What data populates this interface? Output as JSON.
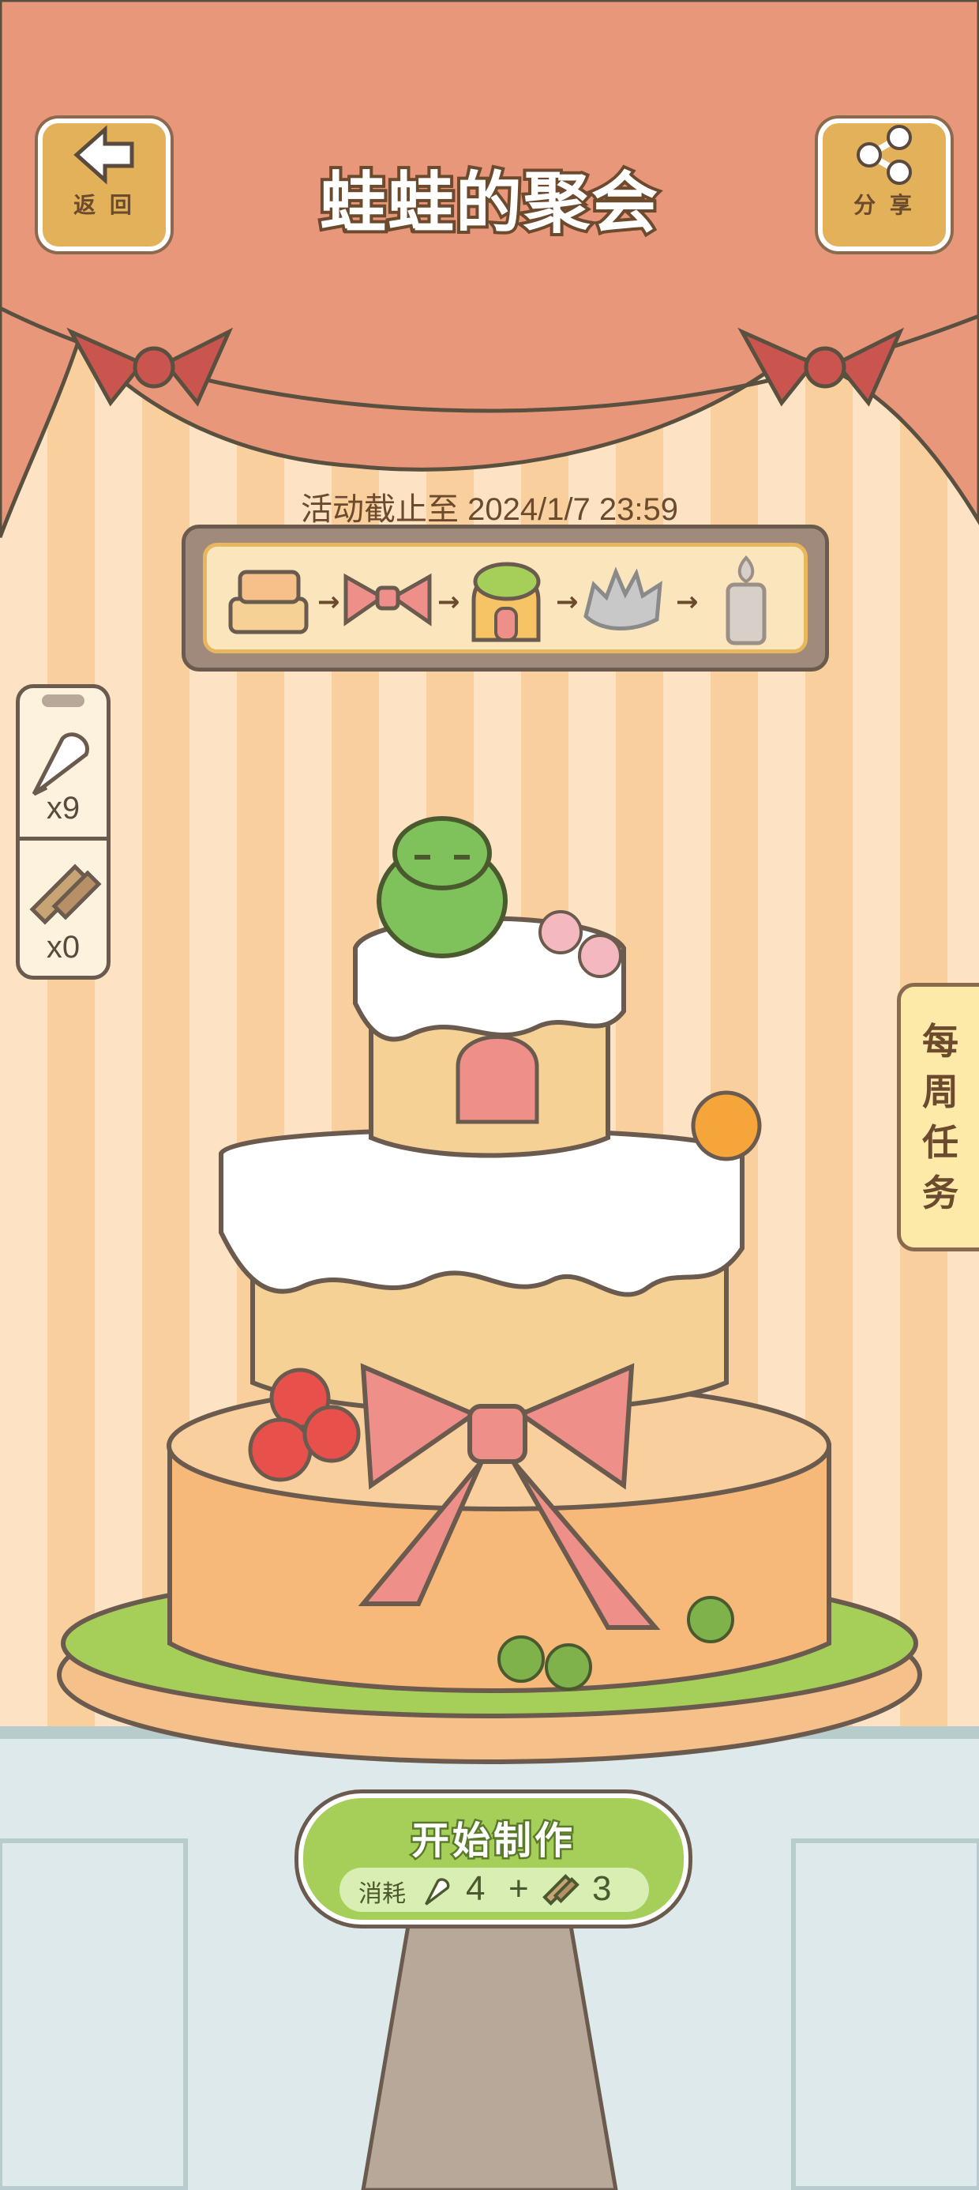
{
  "header": {
    "back_label": "返 回",
    "title": "蛙蛙的聚会",
    "share_label": "分 享"
  },
  "event": {
    "deadline": "活动截止至 2024/1/7 23:59"
  },
  "progress": {
    "steps": [
      "cake-layer-icon",
      "bow-icon",
      "house-cake-icon",
      "hedgehog-icon",
      "candle-icon"
    ],
    "arrow": "→"
  },
  "inventory": {
    "items": [
      {
        "icon": "cream-piping-bag-icon",
        "count": "x9"
      },
      {
        "icon": "spatula-icon",
        "count": "x0"
      }
    ]
  },
  "weekly_tasks": {
    "label_chars": [
      "每",
      "周",
      "任",
      "务"
    ]
  },
  "start": {
    "label": "开始制作",
    "cost_label": "消耗",
    "cost_cream": "4",
    "plus": "+",
    "cost_spatula": "3"
  },
  "colors": {
    "curtain": "#e9977a",
    "stripe_light": "#fde3c3",
    "stripe_dark": "#f9cf9e",
    "button_wood": "#e2b15a",
    "start_green": "#a6cf5a",
    "outline": "#6b5a4e"
  }
}
